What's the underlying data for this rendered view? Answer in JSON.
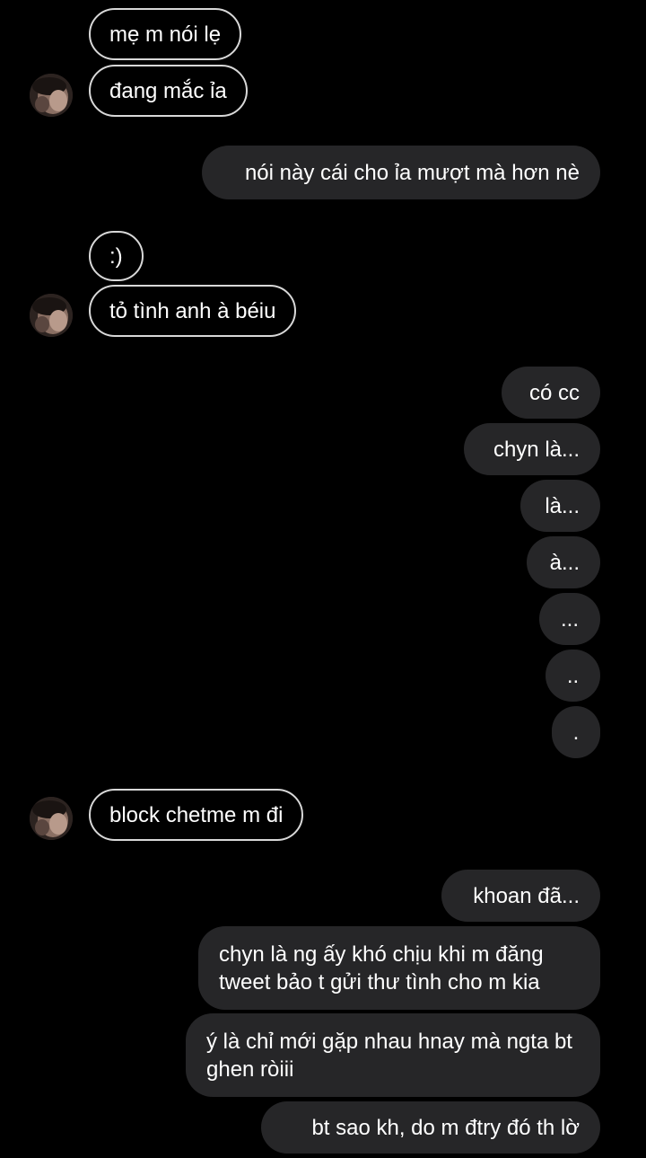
{
  "conversation": {
    "messages": [
      {
        "from": "them",
        "text": "mẹ m nói lẹ"
      },
      {
        "from": "them",
        "text": "đang mắc ỉa"
      },
      {
        "from": "me",
        "text": "nói này cái cho ỉa mượt mà hơn nè"
      },
      {
        "from": "them",
        "text": ":)"
      },
      {
        "from": "them",
        "text": "tỏ tình anh à béiu"
      },
      {
        "from": "me",
        "text": "có cc"
      },
      {
        "from": "me",
        "text": "chyn là..."
      },
      {
        "from": "me",
        "text": "là..."
      },
      {
        "from": "me",
        "text": "à..."
      },
      {
        "from": "me",
        "text": "..."
      },
      {
        "from": "me",
        "text": ".."
      },
      {
        "from": "me",
        "text": "."
      },
      {
        "from": "them",
        "text": "block chetme m đi"
      },
      {
        "from": "me",
        "text": "khoan đã..."
      },
      {
        "from": "me",
        "text": "chyn là ng ấy khó chịu khi m đăng tweet bảo t gửi thư tình cho m kia"
      },
      {
        "from": "me",
        "text": "ý là chỉ mới gặp nhau hnay mà ngta bt ghen ròiii"
      },
      {
        "from": "me",
        "text": "bt sao kh, do m đtry đó th lờ"
      }
    ]
  },
  "colors": {
    "background": "#000000",
    "outgoing_bubble": "#262628",
    "incoming_border": "#d8d8d8",
    "text": "#ffffff"
  }
}
